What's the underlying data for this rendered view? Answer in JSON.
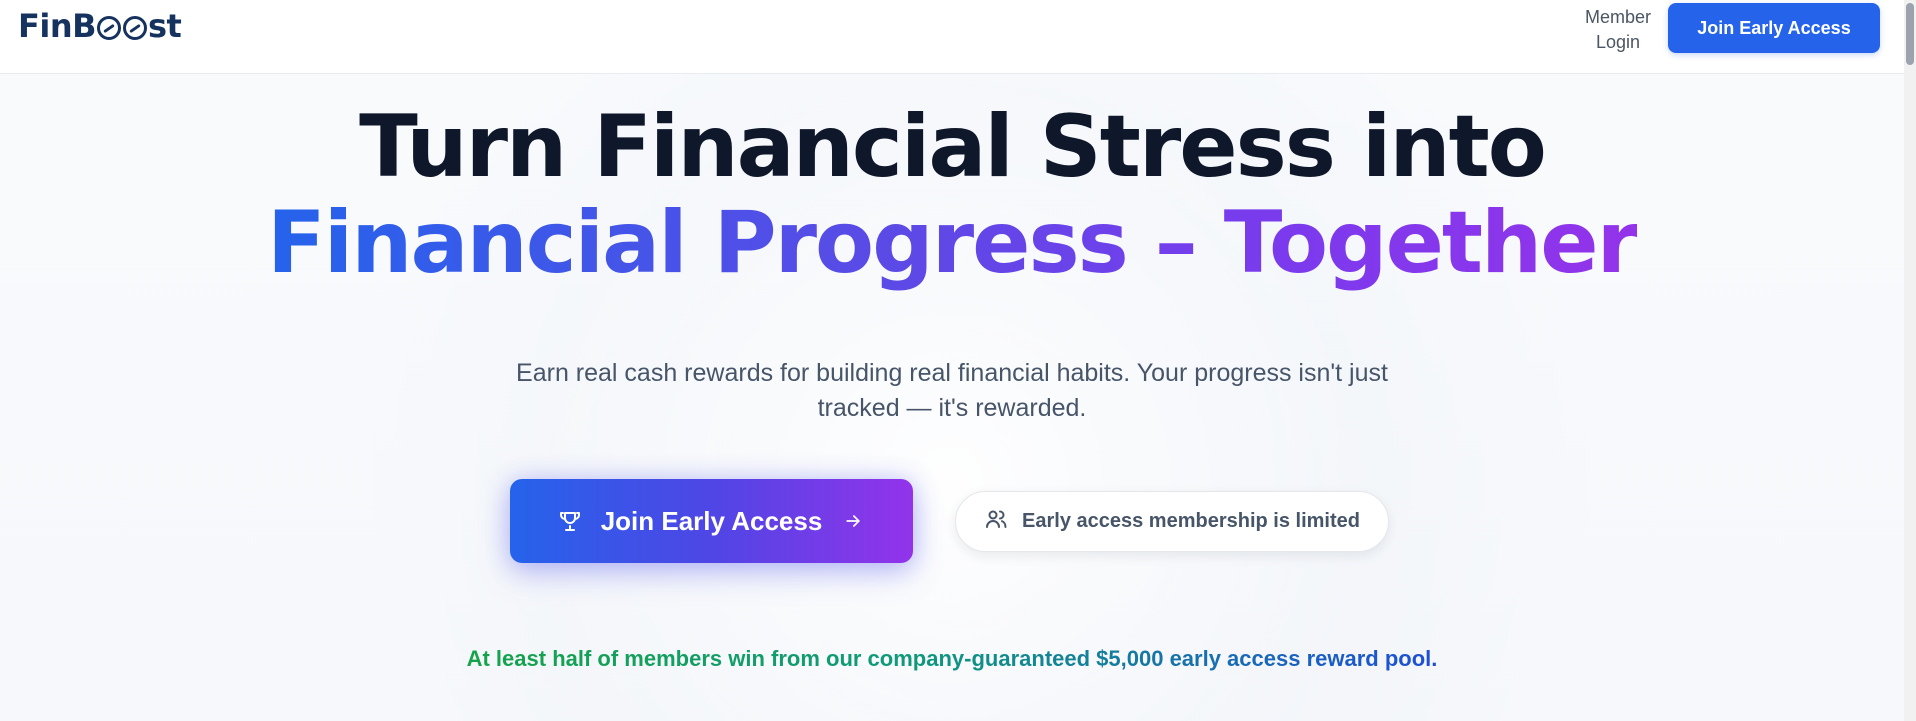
{
  "header": {
    "logo_text_left": "FinB",
    "logo_text_right": "st",
    "member_login_line1": "Member",
    "member_login_line2": "Login",
    "cta_label": "Join Early Access"
  },
  "hero": {
    "title_line1": "Turn Financial Stress into",
    "title_line2": "Financial Progress – Together",
    "subtext": "Earn real cash rewards for building real financial habits. Your progress isn't just tracked — it's rewarded."
  },
  "cta": {
    "primary_label": "Join Early Access",
    "primary_icon": "trophy-icon",
    "arrow_icon": "arrow-right-icon",
    "limited_text": "Early access membership is limited",
    "limited_icon": "users-icon"
  },
  "footer_note": {
    "text": "At least half of members win from our company-guaranteed $5,000 early access reward pool."
  },
  "colors": {
    "brand_navy": "#16335f",
    "primary_blue": "#2563eb",
    "gradient_purple": "#9333ea",
    "note_green": "#16a34a"
  }
}
